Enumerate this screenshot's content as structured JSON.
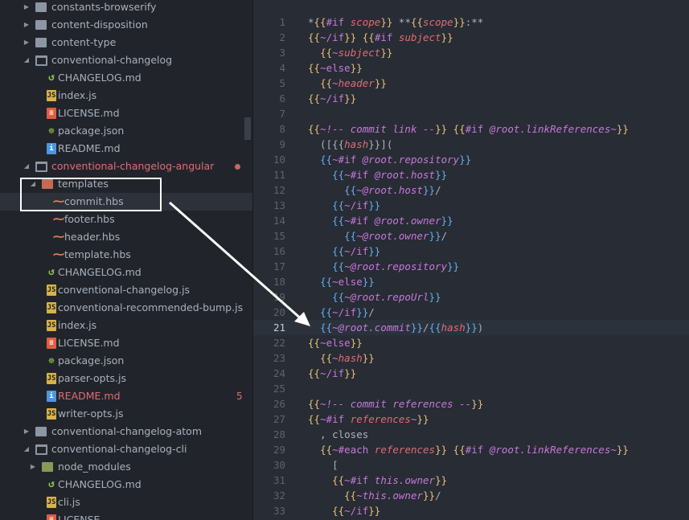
{
  "tree": [
    {
      "label": "constants-browserify",
      "type": "folder",
      "depth": 0,
      "open": false
    },
    {
      "label": "content-disposition",
      "type": "folder",
      "depth": 0,
      "open": false
    },
    {
      "label": "content-type",
      "type": "folder",
      "depth": 0,
      "open": false
    },
    {
      "label": "conventional-changelog",
      "type": "folder",
      "depth": 0,
      "open": true
    },
    {
      "label": "CHANGELOG.md",
      "type": "changelog",
      "depth": 1
    },
    {
      "label": "index.js",
      "type": "js",
      "depth": 1
    },
    {
      "label": "LICENSE.md",
      "type": "license",
      "depth": 1
    },
    {
      "label": "package.json",
      "type": "json",
      "depth": 1
    },
    {
      "label": "README.md",
      "type": "md",
      "depth": 1
    },
    {
      "label": "conventional-changelog-angular",
      "type": "folder",
      "depth": 0,
      "open": true,
      "modified": true,
      "dot": true
    },
    {
      "label": "templates",
      "type": "folder-templates",
      "depth": 1,
      "open": true
    },
    {
      "label": "commit.hbs",
      "type": "hbs",
      "depth": 2,
      "selected": true
    },
    {
      "label": "footer.hbs",
      "type": "hbs",
      "depth": 2
    },
    {
      "label": "header.hbs",
      "type": "hbs",
      "depth": 2
    },
    {
      "label": "template.hbs",
      "type": "hbs",
      "depth": 2
    },
    {
      "label": "CHANGELOG.md",
      "type": "changelog",
      "depth": 1
    },
    {
      "label": "conventional-changelog.js",
      "type": "js",
      "depth": 1
    },
    {
      "label": "conventional-recommended-bump.js",
      "type": "js",
      "depth": 1
    },
    {
      "label": "index.js",
      "type": "js",
      "depth": 1
    },
    {
      "label": "LICENSE.md",
      "type": "license",
      "depth": 1
    },
    {
      "label": "package.json",
      "type": "json",
      "depth": 1
    },
    {
      "label": "parser-opts.js",
      "type": "js",
      "depth": 1
    },
    {
      "label": "README.md",
      "type": "md",
      "depth": 1,
      "modified": true,
      "badge": "5"
    },
    {
      "label": "writer-opts.js",
      "type": "js",
      "depth": 1
    },
    {
      "label": "conventional-changelog-atom",
      "type": "folder",
      "depth": 0,
      "open": false
    },
    {
      "label": "conventional-changelog-cli",
      "type": "folder",
      "depth": 0,
      "open": true
    },
    {
      "label": "node_modules",
      "type": "folder-green",
      "depth": 1,
      "open": false
    },
    {
      "label": "CHANGELOG.md",
      "type": "changelog",
      "depth": 1
    },
    {
      "label": "cli.js",
      "type": "js",
      "depth": 1
    },
    {
      "label": "LICENSE",
      "type": "license",
      "depth": 1
    }
  ],
  "icons": {
    "js": "JS",
    "md": "i",
    "license": "≡",
    "json": "☸",
    "changelog": "↺",
    "hbs": "⁓"
  },
  "editor": {
    "active_line": 21,
    "lines": [
      [
        [
          "x",
          "*"
        ],
        [
          "b",
          "{{"
        ],
        [
          "t",
          "#if "
        ],
        [
          "v",
          "scope"
        ],
        [
          "b",
          "}}"
        ],
        [
          "x",
          " **"
        ],
        [
          "b",
          "{{"
        ],
        [
          "v",
          "scope"
        ],
        [
          "b",
          "}}"
        ],
        [
          "x",
          ":**"
        ]
      ],
      [
        [
          "b",
          "{{"
        ],
        [
          "t",
          "~/if"
        ],
        [
          "b",
          "}}"
        ],
        [
          "x",
          " "
        ],
        [
          "b",
          "{{"
        ],
        [
          "t",
          "#if "
        ],
        [
          "v",
          "subject"
        ],
        [
          "b",
          "}}"
        ]
      ],
      [
        [
          "x",
          "  "
        ],
        [
          "b",
          "{{"
        ],
        [
          "t",
          "~"
        ],
        [
          "v",
          "subject"
        ],
        [
          "b",
          "}}"
        ]
      ],
      [
        [
          "b",
          "{{"
        ],
        [
          "t",
          "~else"
        ],
        [
          "b",
          "}}"
        ]
      ],
      [
        [
          "x",
          "  "
        ],
        [
          "b",
          "{{"
        ],
        [
          "t",
          "~"
        ],
        [
          "v",
          "header"
        ],
        [
          "b",
          "}}"
        ]
      ],
      [
        [
          "b",
          "{{"
        ],
        [
          "t",
          "~/if"
        ],
        [
          "b",
          "}}"
        ]
      ],
      [],
      [
        [
          "b",
          "{{"
        ],
        [
          "c",
          "~!-- commit link --"
        ],
        [
          "b",
          "}}"
        ],
        [
          "x",
          " "
        ],
        [
          "b",
          "{{"
        ],
        [
          "t",
          "#if "
        ],
        [
          "p",
          "@root.linkReferences"
        ],
        [
          "t",
          "~"
        ],
        [
          "b",
          "}}"
        ]
      ],
      [
        [
          "x",
          "  ([{{"
        ],
        [
          "v",
          "hash"
        ],
        [
          "x",
          "}}]("
        ]
      ],
      [
        [
          "x",
          "  "
        ],
        [
          "s",
          "{{"
        ],
        [
          "t",
          "~#if "
        ],
        [
          "p",
          "@root.repository"
        ],
        [
          "s",
          "}}"
        ]
      ],
      [
        [
          "x",
          "    "
        ],
        [
          "s",
          "{{"
        ],
        [
          "t",
          "~#if "
        ],
        [
          "p",
          "@root.host"
        ],
        [
          "s",
          "}}"
        ]
      ],
      [
        [
          "x",
          "      "
        ],
        [
          "s",
          "{{"
        ],
        [
          "t",
          "~"
        ],
        [
          "p",
          "@root.host"
        ],
        [
          "s",
          "}}"
        ],
        [
          "x",
          "/"
        ]
      ],
      [
        [
          "x",
          "    "
        ],
        [
          "s",
          "{{"
        ],
        [
          "t",
          "~/if"
        ],
        [
          "s",
          "}}"
        ]
      ],
      [
        [
          "x",
          "    "
        ],
        [
          "s",
          "{{"
        ],
        [
          "t",
          "~#if "
        ],
        [
          "p",
          "@root.owner"
        ],
        [
          "s",
          "}}"
        ]
      ],
      [
        [
          "x",
          "      "
        ],
        [
          "s",
          "{{"
        ],
        [
          "t",
          "~"
        ],
        [
          "p",
          "@root.owner"
        ],
        [
          "s",
          "}}"
        ],
        [
          "x",
          "/"
        ]
      ],
      [
        [
          "x",
          "    "
        ],
        [
          "s",
          "{{"
        ],
        [
          "t",
          "~/if"
        ],
        [
          "s",
          "}}"
        ]
      ],
      [
        [
          "x",
          "    "
        ],
        [
          "s",
          "{{"
        ],
        [
          "t",
          "~"
        ],
        [
          "p",
          "@root.repository"
        ],
        [
          "s",
          "}}"
        ]
      ],
      [
        [
          "x",
          "  "
        ],
        [
          "s",
          "{{"
        ],
        [
          "t",
          "~else"
        ],
        [
          "s",
          "}}"
        ]
      ],
      [
        [
          "x",
          "    "
        ],
        [
          "s",
          "{{"
        ],
        [
          "t",
          "~"
        ],
        [
          "p",
          "@root.repoUrl"
        ],
        [
          "s",
          "}}"
        ]
      ],
      [
        [
          "x",
          "  "
        ],
        [
          "s",
          "{{"
        ],
        [
          "t",
          "~/if"
        ],
        [
          "s",
          "}}"
        ],
        [
          "x",
          "/"
        ]
      ],
      [
        [
          "x",
          "  "
        ],
        [
          "s",
          "{{"
        ],
        [
          "t",
          "~"
        ],
        [
          "p",
          "@root.commit"
        ],
        [
          "s",
          "}}"
        ],
        [
          "x",
          "/"
        ],
        [
          "s",
          "{{"
        ],
        [
          "v",
          "hash"
        ],
        [
          "s",
          "}}"
        ],
        [
          "x",
          ")"
        ]
      ],
      [
        [
          "b",
          "{{"
        ],
        [
          "t",
          "~else"
        ],
        [
          "b",
          "}}"
        ]
      ],
      [
        [
          "x",
          "  "
        ],
        [
          "b",
          "{{"
        ],
        [
          "t",
          "~"
        ],
        [
          "v",
          "hash"
        ],
        [
          "b",
          "}}"
        ]
      ],
      [
        [
          "b",
          "{{"
        ],
        [
          "t",
          "~/if"
        ],
        [
          "b",
          "}}"
        ]
      ],
      [],
      [
        [
          "b",
          "{{"
        ],
        [
          "c",
          "~!-- commit references --"
        ],
        [
          "b",
          "}}"
        ]
      ],
      [
        [
          "b",
          "{{"
        ],
        [
          "t",
          "~#if "
        ],
        [
          "v",
          "references"
        ],
        [
          "t",
          "~"
        ],
        [
          "b",
          "}}"
        ]
      ],
      [
        [
          "x",
          "  , closes"
        ]
      ],
      [
        [
          "x",
          "  "
        ],
        [
          "b",
          "{{"
        ],
        [
          "t",
          "~#each "
        ],
        [
          "v",
          "references"
        ],
        [
          "b",
          "}}"
        ],
        [
          "x",
          " "
        ],
        [
          "b",
          "{{"
        ],
        [
          "t",
          "#if "
        ],
        [
          "p",
          "@root.linkReferences"
        ],
        [
          "t",
          "~"
        ],
        [
          "b",
          "}}"
        ]
      ],
      [
        [
          "x",
          "    ["
        ]
      ],
      [
        [
          "x",
          "    "
        ],
        [
          "b",
          "{{"
        ],
        [
          "t",
          "~#if "
        ],
        [
          "p",
          "this.owner"
        ],
        [
          "b",
          "}}"
        ]
      ],
      [
        [
          "x",
          "      "
        ],
        [
          "b",
          "{{"
        ],
        [
          "t",
          "~"
        ],
        [
          "p",
          "this.owner"
        ],
        [
          "b",
          "}}"
        ],
        [
          "x",
          "/"
        ]
      ],
      [
        [
          "x",
          "    "
        ],
        [
          "b",
          "{{"
        ],
        [
          "t",
          "~/if"
        ],
        [
          "b",
          "}}"
        ]
      ]
    ]
  }
}
